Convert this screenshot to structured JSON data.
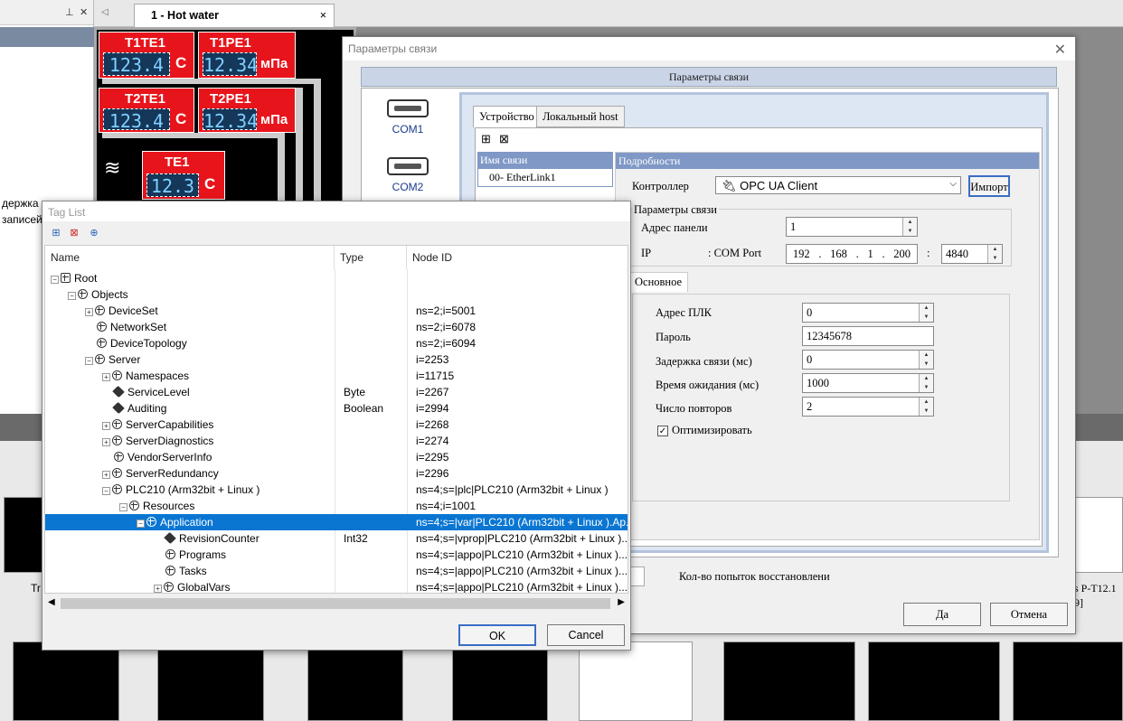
{
  "left_pane": {
    "line1": "держка",
    "line2": "записей"
  },
  "tabs": {
    "active": "1 - Hot water",
    "close": "×"
  },
  "canvas": {
    "tags": [
      {
        "title": "T1TE1",
        "value": "123.4",
        "unit": "C"
      },
      {
        "title": "T1PE1",
        "value": "12.34",
        "unit": "мПа"
      },
      {
        "title": "T2TE1",
        "value": "123.4",
        "unit": "C"
      },
      {
        "title": "T2PE1",
        "value": "12.34",
        "unit": "мПа"
      },
      {
        "title": "TE1",
        "value": "12.3",
        "unit": "C"
      }
    ]
  },
  "bottom": {
    "left_label": "Tr",
    "right_label": "ps P-T12.1",
    "right_sub": "9]"
  },
  "params": {
    "window_title": "Параметры связи",
    "header": "Параметры связи",
    "com1": "COM1",
    "com2": "COM2",
    "tab_device": "Устройство",
    "tab_local": "Локальный host",
    "list_header": "Имя связи",
    "list_items": [
      "00- EtherLink1"
    ],
    "details_header": "Подробности",
    "controller_label": "Контроллер",
    "controller_value": "OPC UA Client",
    "import_button": "Импорт",
    "conn_params_title": "Параметры связи",
    "panel_addr_label": "Адрес панели",
    "panel_addr_value": "1",
    "ip_label": "IP",
    "com_port_label": ": COM Port",
    "ip": [
      "192",
      "168",
      "1",
      "200"
    ],
    "port": "4840",
    "tab_main": "Основное",
    "plc_addr_label": "Адрес ПЛК",
    "plc_addr_value": "0",
    "password_label": "Пароль",
    "password_value": "12345678",
    "delay_label": "Задержка связи (мс)",
    "delay_value": "0",
    "timeout_label": "Время ожидания (мс)",
    "timeout_value": "1000",
    "retries_label": "Число повторов",
    "retries_value": "2",
    "optimize_label": "Оптимизировать",
    "optimize_checked": true,
    "recovery_label": "Кол-во попыток восстановлени",
    "ok_button": "Да",
    "cancel_button": "Отмена"
  },
  "taglist": {
    "window_title": "Tag List",
    "columns": [
      "Name",
      "Type",
      "Node ID"
    ],
    "rows": [
      {
        "name": "Root",
        "type": "",
        "node": "",
        "level": 0,
        "icon": "root",
        "exp": "−"
      },
      {
        "name": "Objects",
        "type": "",
        "node": "",
        "level": 1,
        "icon": "node",
        "exp": "−"
      },
      {
        "name": "DeviceSet",
        "type": "",
        "node": "ns=2;i=5001",
        "level": 2,
        "icon": "node",
        "exp": "+"
      },
      {
        "name": "NetworkSet",
        "type": "",
        "node": "ns=2;i=6078",
        "level": 2,
        "icon": "node",
        "exp": ""
      },
      {
        "name": "DeviceTopology",
        "type": "",
        "node": "ns=2;i=6094",
        "level": 2,
        "icon": "node",
        "exp": ""
      },
      {
        "name": "Server",
        "type": "",
        "node": "i=2253",
        "level": 2,
        "icon": "node",
        "exp": "−"
      },
      {
        "name": "Namespaces",
        "type": "",
        "node": "i=11715",
        "level": 3,
        "icon": "node",
        "exp": "+"
      },
      {
        "name": "ServiceLevel",
        "type": "Byte",
        "node": "i=2267",
        "level": 3,
        "icon": "tag",
        "exp": ""
      },
      {
        "name": "Auditing",
        "type": "Boolean",
        "node": "i=2994",
        "level": 3,
        "icon": "tag",
        "exp": ""
      },
      {
        "name": "ServerCapabilities",
        "type": "",
        "node": "i=2268",
        "level": 3,
        "icon": "node",
        "exp": "+"
      },
      {
        "name": "ServerDiagnostics",
        "type": "",
        "node": "i=2274",
        "level": 3,
        "icon": "node",
        "exp": "+"
      },
      {
        "name": "VendorServerInfo",
        "type": "",
        "node": "i=2295",
        "level": 3,
        "icon": "node",
        "exp": ""
      },
      {
        "name": "ServerRedundancy",
        "type": "",
        "node": "i=2296",
        "level": 3,
        "icon": "node",
        "exp": "+"
      },
      {
        "name": "PLC210 (Arm32bit + Linux )",
        "type": "",
        "node": "ns=4;s=|plc|PLC210 (Arm32bit + Linux )",
        "level": 3,
        "icon": "node",
        "exp": "−"
      },
      {
        "name": "Resources",
        "type": "",
        "node": "ns=4;i=1001",
        "level": 4,
        "icon": "node",
        "exp": "−"
      },
      {
        "name": "Application",
        "type": "",
        "node": "ns=4;s=|var|PLC210 (Arm32bit + Linux ).Ap...",
        "level": 5,
        "icon": "node",
        "exp": "−",
        "selected": true
      },
      {
        "name": "RevisionCounter",
        "type": "Int32",
        "node": "ns=4;s=|vprop|PLC210 (Arm32bit + Linux )....",
        "level": 6,
        "icon": "tag",
        "exp": ""
      },
      {
        "name": "Programs",
        "type": "",
        "node": "ns=4;s=|appo|PLC210 (Arm32bit + Linux )....",
        "level": 6,
        "icon": "node",
        "exp": ""
      },
      {
        "name": "Tasks",
        "type": "",
        "node": "ns=4;s=|appo|PLC210 (Arm32bit + Linux )....",
        "level": 6,
        "icon": "node",
        "exp": ""
      },
      {
        "name": "GlobalVars",
        "type": "",
        "node": "ns=4;s=|appo|PLC210 (Arm32bit + Linux )....",
        "level": 6,
        "icon": "node",
        "exp": "+"
      }
    ],
    "ok_button": "OK",
    "cancel_button": "Cancel"
  }
}
